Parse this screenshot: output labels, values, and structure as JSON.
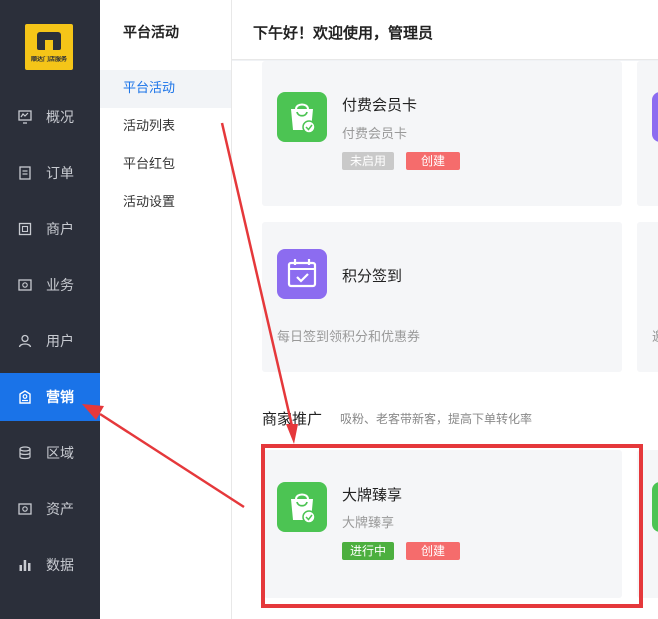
{
  "logo": {
    "text": "顺达门店服务"
  },
  "nav": {
    "items": [
      {
        "label": "概况",
        "icon": "monitor-icon"
      },
      {
        "label": "订单",
        "icon": "document-icon"
      },
      {
        "label": "商户",
        "icon": "store-icon"
      },
      {
        "label": "业务",
        "icon": "briefcase-icon"
      },
      {
        "label": "用户",
        "icon": "user-icon"
      },
      {
        "label": "营销",
        "icon": "marketing-icon"
      },
      {
        "label": "区域",
        "icon": "database-icon"
      },
      {
        "label": "资产",
        "icon": "asset-icon"
      },
      {
        "label": "数据",
        "icon": "bar-chart-icon"
      }
    ],
    "active": "营销"
  },
  "subnav": {
    "title": "平台活动",
    "items": [
      "平台活动",
      "活动列表",
      "平台红包",
      "活动设置"
    ],
    "active": "平台活动"
  },
  "header": {
    "greeting": "下午好！欢迎使用，管理员"
  },
  "cards": [
    {
      "title": "付费会员卡",
      "desc": "付费会员卡",
      "tags": [
        "未启用",
        "创建"
      ],
      "icon": "shopping-bag-icon",
      "color": "#4cc453"
    },
    {
      "title": "积分签到",
      "desc": "每日签到领积分和优惠券",
      "icon": "calendar-check-icon",
      "color": "#8c6cf0"
    }
  ],
  "section": {
    "title": "商家推广",
    "subtitle": "吸粉、老客带新客，提高下单转化率"
  },
  "promo_card": {
    "title": "大牌臻享",
    "desc": "大牌臻享",
    "tags": [
      "进行中",
      "创建"
    ],
    "icon": "shopping-bag-icon"
  },
  "side_cut_text": "邀",
  "colors": {
    "accent": "#1a73e8",
    "highlight": "#e5383b",
    "nav_bg": "#2b2f3a"
  }
}
